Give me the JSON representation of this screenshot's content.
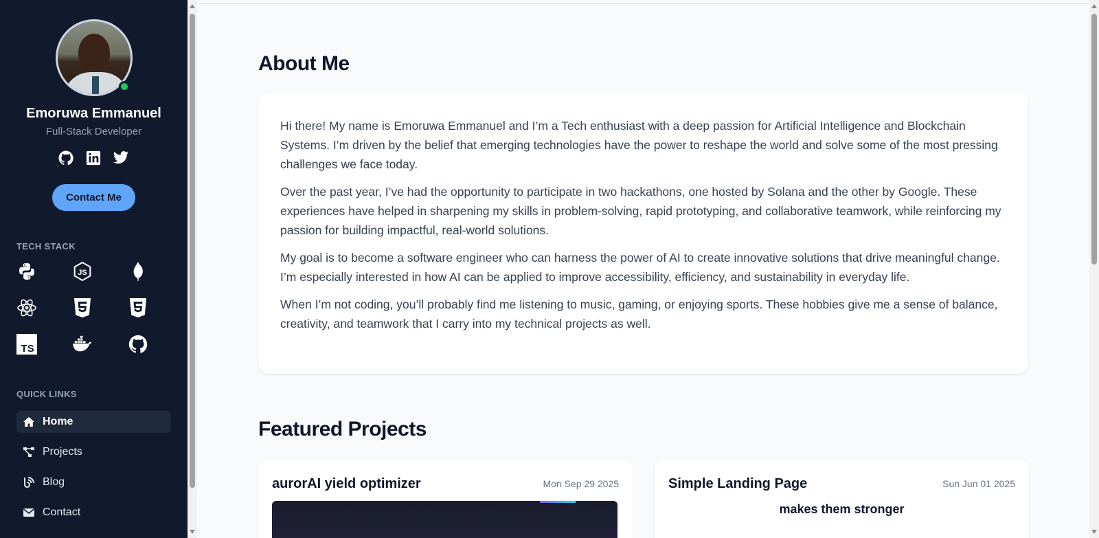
{
  "profile": {
    "name": "Emoruwa Emmanuel",
    "role": "Full-Stack Developer",
    "contact_label": "Contact Me",
    "socials": [
      "github-icon",
      "linkedin-icon",
      "twitter-icon"
    ]
  },
  "tech_stack": {
    "label": "TECH STACK",
    "items": [
      "python-icon",
      "nodejs-icon",
      "mongodb-icon",
      "react-icon",
      "html5-icon",
      "css3-icon",
      "typescript-icon",
      "docker-icon",
      "github-icon"
    ]
  },
  "quick_links": {
    "label": "QUICK LINKS",
    "items": [
      {
        "label": "Home",
        "icon": "home-icon",
        "active": true
      },
      {
        "label": "Projects",
        "icon": "project-diagram-icon",
        "active": false
      },
      {
        "label": "Blog",
        "icon": "blog-icon",
        "active": false
      },
      {
        "label": "Contact",
        "icon": "envelope-icon",
        "active": false
      }
    ]
  },
  "about": {
    "title": "About Me",
    "paragraphs": [
      "Hi there! My name is Emoruwa Emmanuel and I’m a Tech enthusiast with a deep passion for Artificial Intelligence and Blockchain Systems. I’m driven by the belief that emerging technologies have the power to reshape the world and solve some of the most pressing challenges we face today.",
      "Over the past year, I’ve had the opportunity to participate in two hackathons, one hosted by Solana and the other by Google. These experiences have helped in sharpening my skills in problem-solving, rapid prototyping, and collaborative teamwork, while reinforcing my passion for building impactful, real-world solutions.",
      "My goal is to become a software engineer who can harness the power of AI to create innovative solutions that drive meaningful change. I’m especially interested in how AI can be applied to improve accessibility, efficiency, and sustainability in everyday life.",
      "When I’m not coding, you’ll probably find me listening to music, gaming, or enjoying sports. These hobbies give me a sense of balance, creativity, and teamwork that I carry into my technical projects as well."
    ]
  },
  "projects": {
    "title": "Featured Projects",
    "items": [
      {
        "title": "aurorAI yield optimizer",
        "date": "Mon Sep 29 2025"
      },
      {
        "title": "Simple Landing Page",
        "date": "Sun Jun 01 2025",
        "preview_text": "makes them stronger"
      }
    ]
  },
  "colors": {
    "sidebar_bg": "#111a2c",
    "accent": "#60a5fa",
    "online": "#22c55e"
  }
}
